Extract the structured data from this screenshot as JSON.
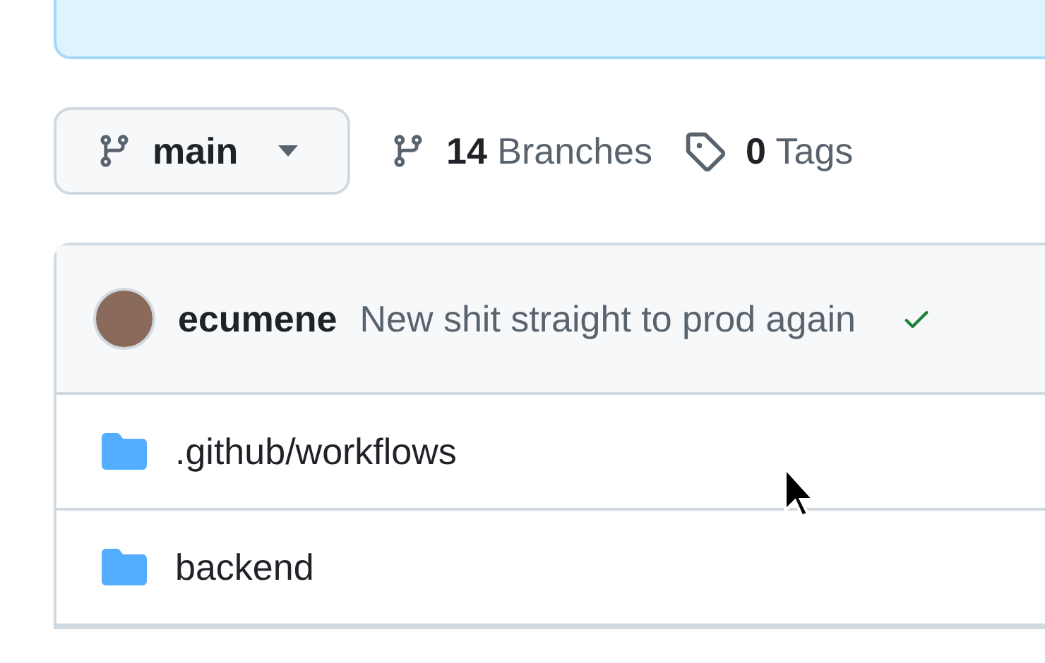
{
  "branch_selector": {
    "label": "main"
  },
  "branches": {
    "count": "14",
    "label": "Branches"
  },
  "tags": {
    "count": "0",
    "label": "Tags"
  },
  "latest_commit": {
    "author": "ecumene",
    "message": "New shit straight to prod again",
    "checks_passed": true
  },
  "files": [
    {
      "name": ".github/workflows",
      "kind": "folder"
    },
    {
      "name": "backend",
      "kind": "folder"
    }
  ]
}
